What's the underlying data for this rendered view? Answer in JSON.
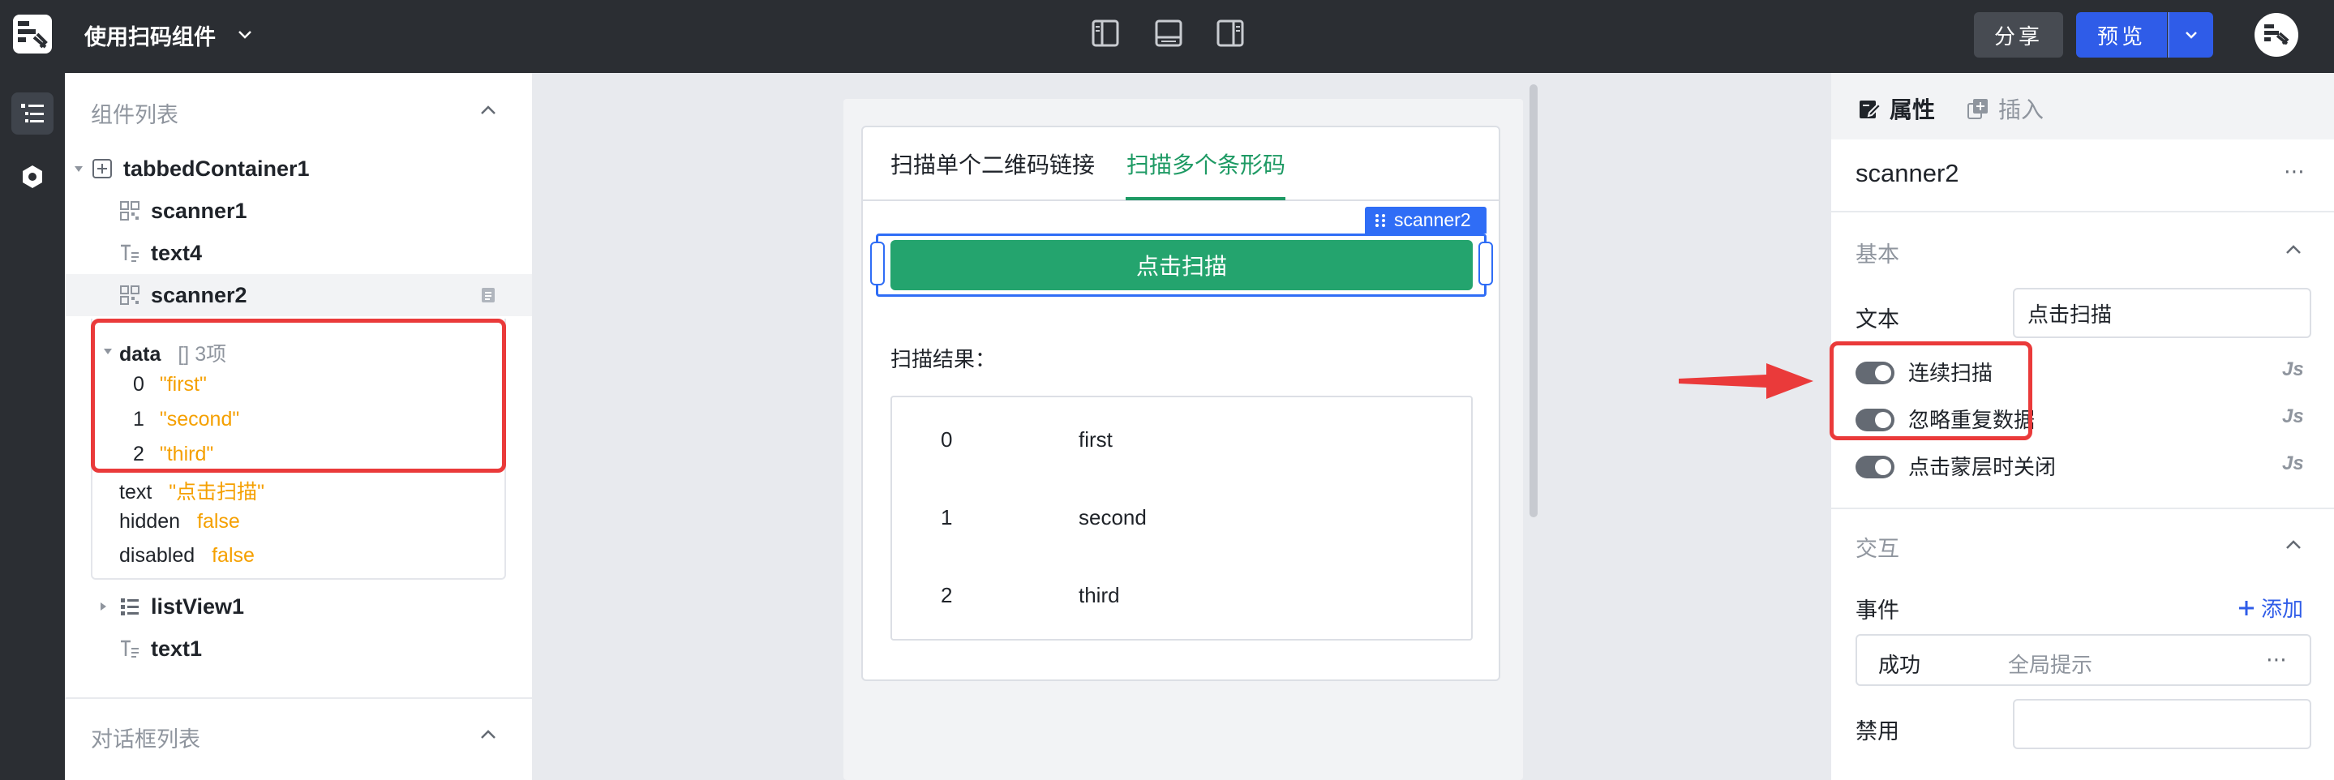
{
  "app": {
    "title": "使用扫码组件"
  },
  "toolbar": {
    "share_label": "分享",
    "preview_label": "预览"
  },
  "left_panel": {
    "components_header": "组件列表",
    "dialogs_header": "对话框列表",
    "tree": [
      {
        "name": "tabbedContainer1",
        "icon": "container-icon"
      },
      {
        "name": "scanner1",
        "icon": "qrcode-icon"
      },
      {
        "name": "text4",
        "icon": "text-icon"
      },
      {
        "name": "scanner2",
        "icon": "qrcode-icon"
      },
      {
        "name": "listView1",
        "icon": "list-icon"
      },
      {
        "name": "text1",
        "icon": "text-icon"
      }
    ],
    "inspector": {
      "data_key": "data",
      "data_meta": "[] 3项",
      "data_items": [
        {
          "index": "0",
          "value": "\"first\""
        },
        {
          "index": "1",
          "value": "\"second\""
        },
        {
          "index": "2",
          "value": "\"third\""
        }
      ],
      "props": [
        {
          "key": "text",
          "value": "\"点击扫描\""
        },
        {
          "key": "hidden",
          "value": "false"
        },
        {
          "key": "disabled",
          "value": "false"
        }
      ]
    }
  },
  "canvas": {
    "tabs": [
      "扫描单个二维码链接",
      "扫描多个条形码"
    ],
    "active_tab": 1,
    "selected_component": "scanner2",
    "scan_button_label": "点击扫描",
    "result_label": "扫描结果：",
    "results": [
      {
        "index": "0",
        "value": "first"
      },
      {
        "index": "1",
        "value": "second"
      },
      {
        "index": "2",
        "value": "third"
      }
    ]
  },
  "right_panel": {
    "tabs": [
      "属性",
      "插入"
    ],
    "component_name": "scanner2",
    "basic_section": "基本",
    "text_label": "文本",
    "text_value": "点击扫描",
    "toggles": [
      {
        "label": "连续扫描",
        "on": true
      },
      {
        "label": "忽略重复数据",
        "on": true
      },
      {
        "label": "点击蒙层时关闭",
        "on": true
      }
    ],
    "js_badge": "Js",
    "interaction_section": "交互",
    "events_label": "事件",
    "add_label": "添加",
    "event": {
      "name": "成功",
      "action": "全局提示"
    },
    "disable_label": "禁用"
  },
  "colors": {
    "accent_green": "#24a46e",
    "brand_blue": "#2f5ce8",
    "highlight_red": "#ea3a3a",
    "string_orange": "#f5a000"
  }
}
